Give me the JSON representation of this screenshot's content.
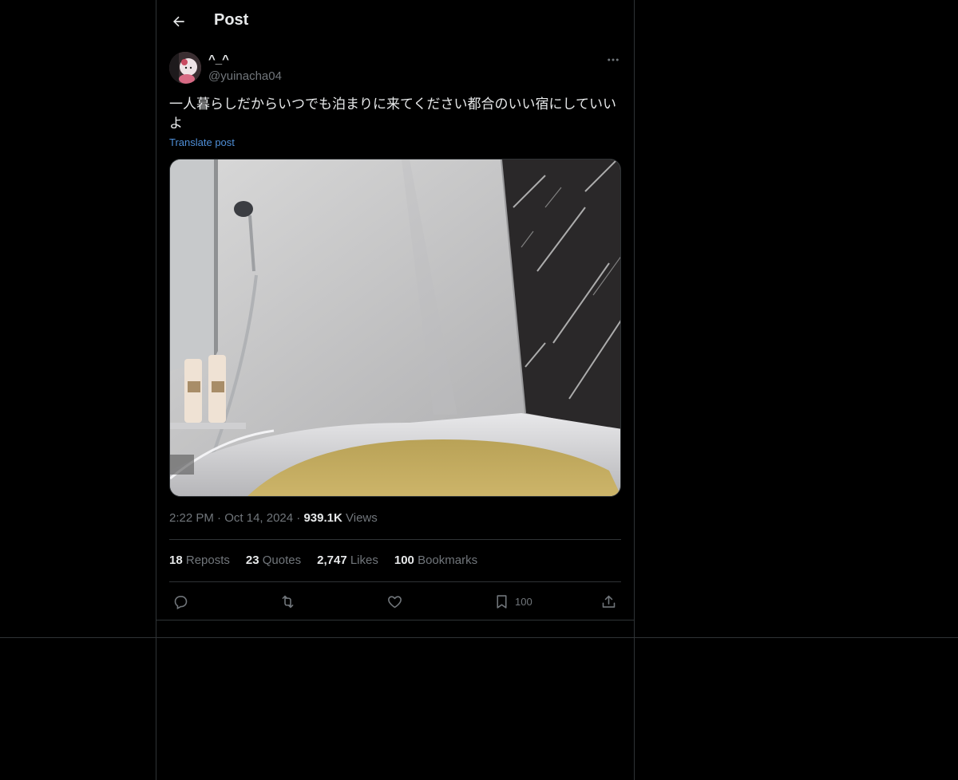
{
  "header": {
    "title": "Post"
  },
  "author": {
    "display_name": "^_^",
    "handle": "@yuinacha04"
  },
  "post": {
    "text": "一人暮らしだからいつでも泊まりに来てください都合のいい宿にしていいよ",
    "translate_label": "Translate post",
    "media_icon": "bathtub-photo"
  },
  "meta": {
    "time": "2:22 PM",
    "date": "Oct 14, 2024",
    "separator": " · ",
    "views_count": "939.1K",
    "views_label": "Views"
  },
  "stats": {
    "reposts_count": "18",
    "reposts_label": "Reposts",
    "quotes_count": "23",
    "quotes_label": "Quotes",
    "likes_count": "2,747",
    "likes_label": "Likes",
    "bookmarks_count": "100",
    "bookmarks_label": "Bookmarks"
  },
  "actions": {
    "bookmark_count": "100"
  },
  "colors": {
    "background": "#000000",
    "border": "#2f3336",
    "muted": "#71767b",
    "link": "#4f8fd8",
    "text": "#e7e9ea"
  }
}
